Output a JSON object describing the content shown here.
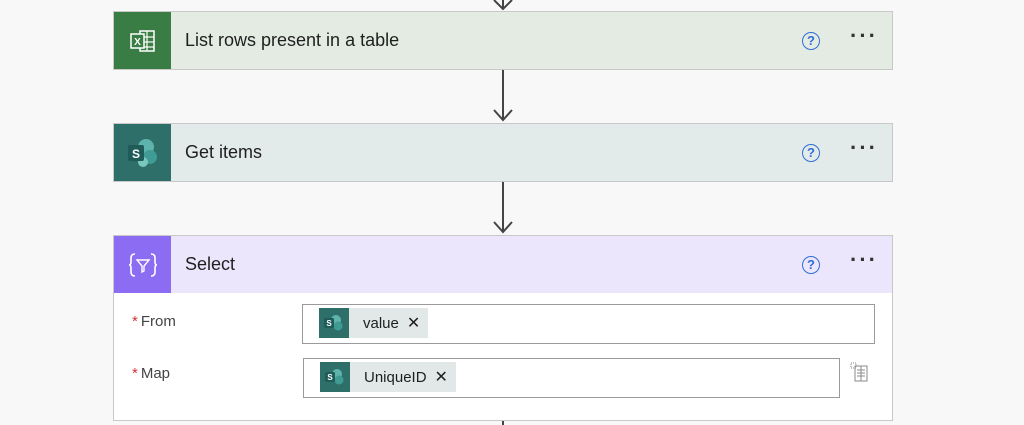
{
  "colors": {
    "excel_tile": "#3a7d44",
    "excel_header": "#e3ebe3",
    "sharepoint_tile": "#2e6f6a",
    "sharepoint_header": "#e2eaea",
    "select_tile": "#8c6cf2",
    "select_header": "#ebe6fb",
    "help_blue": "#2f6fd6",
    "required_red": "#d13438"
  },
  "steps": [
    {
      "title": "List rows present in a table",
      "icon": "excel-icon",
      "help": "?",
      "more": "···"
    },
    {
      "title": "Get items",
      "icon": "sharepoint-icon",
      "help": "?",
      "more": "···"
    },
    {
      "title": "Select",
      "icon": "data-operation-icon",
      "help": "?",
      "more": "···"
    }
  ],
  "select_fields": {
    "from": {
      "label": "From",
      "required": "*",
      "token": "value",
      "token_icon": "sharepoint-icon"
    },
    "map": {
      "label": "Map",
      "required": "*",
      "token": "UniqueID",
      "token_icon": "sharepoint-icon"
    }
  },
  "glyphs": {
    "close": "✕"
  }
}
